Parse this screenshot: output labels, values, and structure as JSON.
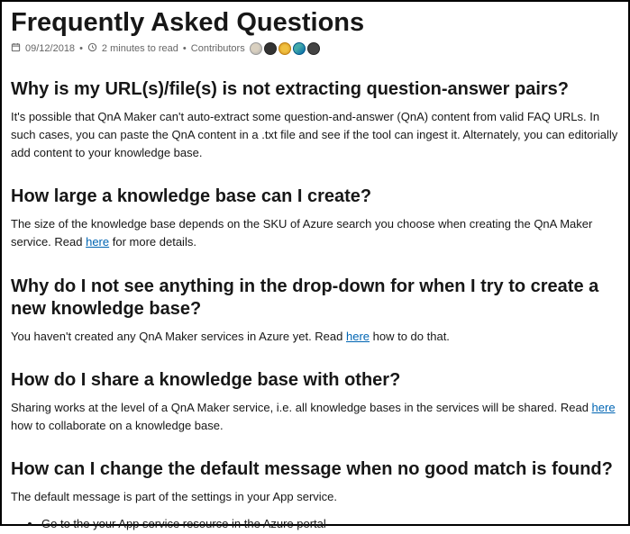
{
  "page": {
    "title": "Frequently Asked Questions",
    "date": "09/12/2018",
    "read_time": "2 minutes to read",
    "contributors_label": "Contributors"
  },
  "faq": [
    {
      "question": "Why is my URL(s)/file(s) is not extracting question-answer pairs?",
      "answer_pre": "It's possible that QnA Maker can't auto-extract some question-and-answer (QnA) content from valid FAQ URLs. In such cases, you can paste the QnA content in a .txt file and see if the tool can ingest it. Alternately, you can editorially add content to your knowledge base.",
      "link": null,
      "answer_post": null
    },
    {
      "question": "How large a knowledge base can I create?",
      "answer_pre": "The size of the knowledge base depends on the SKU of Azure search you choose when creating the QnA Maker service. Read ",
      "link": "here",
      "answer_post": " for more details."
    },
    {
      "question": "Why do I not see anything in the drop-down for when I try to create a new knowledge base?",
      "answer_pre": "You haven't created any QnA Maker services in Azure yet. Read ",
      "link": "here",
      "answer_post": " how to do that."
    },
    {
      "question": "How do I share a knowledge base with other?",
      "answer_pre": "Sharing works at the level of a QnA Maker service, i.e. all knowledge bases in the services will be shared. Read ",
      "link": "here",
      "answer_post": " how to collaborate on a knowledge base."
    },
    {
      "question": "How can I change the default message when no good match is found?",
      "answer_pre": "The default message is part of the settings in your App service.",
      "link": null,
      "answer_post": null,
      "bullets": [
        "Go to the your App service resource in the Azure portal"
      ]
    }
  ]
}
